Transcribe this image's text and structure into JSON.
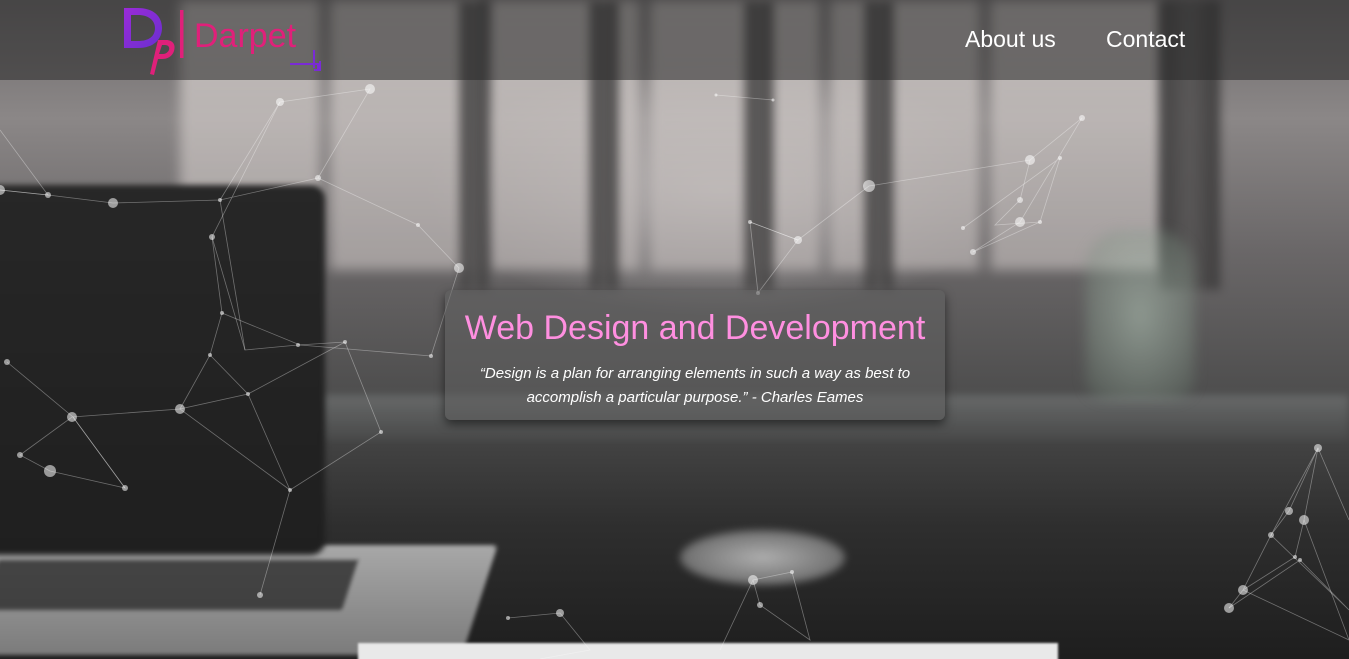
{
  "logo": {
    "mark_letters": "DP",
    "name": "Darpet"
  },
  "nav": {
    "about_label": "About us",
    "contact_label": "Contact"
  },
  "hero": {
    "title": "Web Design and Development",
    "quote": "“Design is a plan for arranging elements in such a way as best to accomplish a particular purpose.” - Charles Eames"
  },
  "colors": {
    "title_pink": "#ff8fe0",
    "logo_purple": "#7a2bd6",
    "logo_magenta": "#e0207a",
    "header_overlay": "#282828"
  }
}
